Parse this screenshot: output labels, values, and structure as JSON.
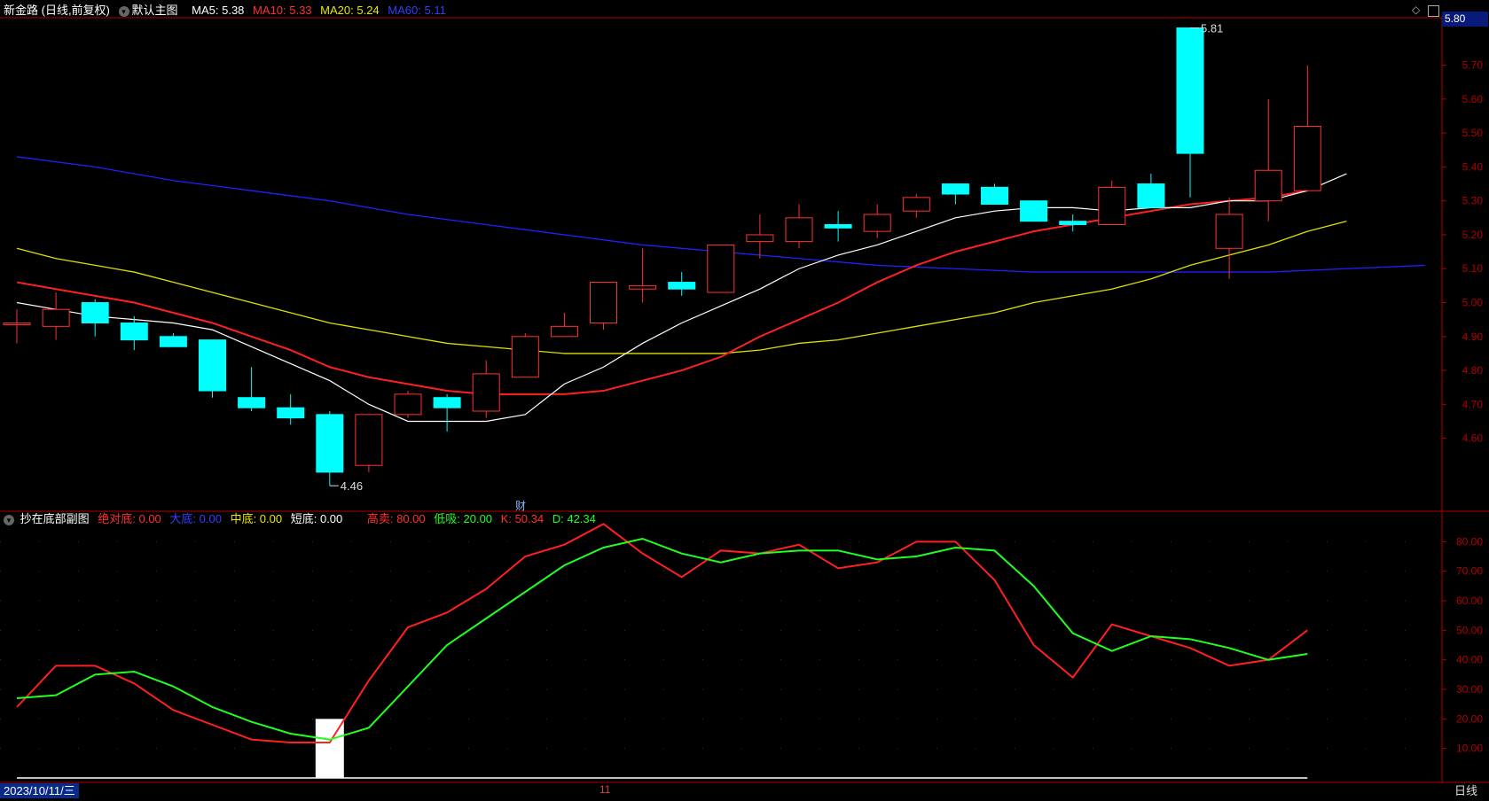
{
  "header": {
    "stock_name": "新金路 (日线,前复权)",
    "chart_mode": "默认主图",
    "ma5_label": "MA5: 5.38",
    "ma10_label": "MA10: 5.33",
    "ma20_label": "MA20: 5.24",
    "ma60_label": "MA60: 5.11"
  },
  "sub_header": {
    "indicator_name": "抄在底部副图",
    "abs_bottom": "绝对底: 0.00",
    "big_bottom": "大底: 0.00",
    "mid_bottom": "中底: 0.00",
    "short_bottom": "短底: 0.00",
    "high_sell": "高卖: 80.00",
    "low_buy": "低吸: 20.00",
    "k_value": "K: 50.34",
    "d_value": "D: 42.34"
  },
  "colors": {
    "up": "#ff3232",
    "down": "#00ffff",
    "ma5": "#ffffff",
    "ma10": "#ff2020",
    "ma20": "#e0e000",
    "ma60": "#2020ff",
    "k": "#ff2020",
    "d": "#20ff20",
    "axis": "#b00000"
  },
  "footer": {
    "date": "2023/10/11/三",
    "period": "日线",
    "month_mark": "11",
    "fin_mark": "财"
  },
  "price_badge": "5.80",
  "max_label": "5.81",
  "min_label": "4.46",
  "chart_data": [
    {
      "type": "candlestick",
      "yaxis_ticks": [
        "5.70",
        "5.60",
        "5.50",
        "5.40",
        "5.30",
        "5.20",
        "5.10",
        "5.00",
        "4.90",
        "4.80",
        "4.70",
        "4.60"
      ],
      "ylim": [
        4.39,
        5.84
      ],
      "candles": [
        {
          "o": 4.94,
          "h": 4.98,
          "l": 4.88,
          "c": 4.94
        },
        {
          "o": 4.93,
          "h": 5.03,
          "l": 4.89,
          "c": 4.98
        },
        {
          "o": 5.0,
          "h": 5.01,
          "l": 4.9,
          "c": 4.94
        },
        {
          "o": 4.94,
          "h": 4.96,
          "l": 4.86,
          "c": 4.89
        },
        {
          "o": 4.9,
          "h": 4.91,
          "l": 4.87,
          "c": 4.87
        },
        {
          "o": 4.89,
          "h": 4.89,
          "l": 4.72,
          "c": 4.74
        },
        {
          "o": 4.72,
          "h": 4.81,
          "l": 4.68,
          "c": 4.69
        },
        {
          "o": 4.69,
          "h": 4.73,
          "l": 4.64,
          "c": 4.66
        },
        {
          "o": 4.67,
          "h": 4.68,
          "l": 4.46,
          "c": 4.5
        },
        {
          "o": 4.52,
          "h": 4.67,
          "l": 4.5,
          "c": 4.67
        },
        {
          "o": 4.67,
          "h": 4.74,
          "l": 4.66,
          "c": 4.73
        },
        {
          "o": 4.72,
          "h": 4.73,
          "l": 4.62,
          "c": 4.69
        },
        {
          "o": 4.68,
          "h": 4.83,
          "l": 4.66,
          "c": 4.79
        },
        {
          "o": 4.78,
          "h": 4.91,
          "l": 4.78,
          "c": 4.9
        },
        {
          "o": 4.9,
          "h": 4.97,
          "l": 4.9,
          "c": 4.93
        },
        {
          "o": 4.94,
          "h": 5.06,
          "l": 4.92,
          "c": 5.06
        },
        {
          "o": 5.04,
          "h": 5.16,
          "l": 5.0,
          "c": 5.05
        },
        {
          "o": 5.06,
          "h": 5.09,
          "l": 5.02,
          "c": 5.04
        },
        {
          "o": 5.03,
          "h": 5.17,
          "l": 5.03,
          "c": 5.17
        },
        {
          "o": 5.18,
          "h": 5.26,
          "l": 5.13,
          "c": 5.2
        },
        {
          "o": 5.18,
          "h": 5.29,
          "l": 5.16,
          "c": 5.25
        },
        {
          "o": 5.23,
          "h": 5.27,
          "l": 5.18,
          "c": 5.22
        },
        {
          "o": 5.21,
          "h": 5.29,
          "l": 5.19,
          "c": 5.26
        },
        {
          "o": 5.27,
          "h": 5.32,
          "l": 5.25,
          "c": 5.31
        },
        {
          "o": 5.35,
          "h": 5.35,
          "l": 5.29,
          "c": 5.32
        },
        {
          "o": 5.34,
          "h": 5.35,
          "l": 5.29,
          "c": 5.29
        },
        {
          "o": 5.3,
          "h": 5.3,
          "l": 5.24,
          "c": 5.24
        },
        {
          "o": 5.24,
          "h": 5.26,
          "l": 5.21,
          "c": 5.23
        },
        {
          "o": 5.23,
          "h": 5.36,
          "l": 5.23,
          "c": 5.34
        },
        {
          "o": 5.35,
          "h": 5.38,
          "l": 5.28,
          "c": 5.28
        },
        {
          "o": 5.81,
          "h": 5.81,
          "l": 5.31,
          "c": 5.44
        },
        {
          "o": 5.16,
          "h": 5.31,
          "l": 5.07,
          "c": 5.26
        },
        {
          "o": 5.3,
          "h": 5.6,
          "l": 5.24,
          "c": 5.39
        },
        {
          "o": 5.33,
          "h": 5.7,
          "l": 5.33,
          "c": 5.52
        }
      ],
      "ma5": [
        5.0,
        4.98,
        4.96,
        4.95,
        4.94,
        4.92,
        4.87,
        4.82,
        4.77,
        4.7,
        4.65,
        4.65,
        4.65,
        4.67,
        4.76,
        4.81,
        4.88,
        4.94,
        4.99,
        5.04,
        5.1,
        5.14,
        5.17,
        5.21,
        5.25,
        5.27,
        5.28,
        5.28,
        5.27,
        5.28,
        5.28,
        5.3,
        5.3,
        5.33,
        5.38
      ],
      "ma10": [
        5.06,
        5.04,
        5.02,
        5.0,
        4.97,
        4.94,
        4.9,
        4.86,
        4.81,
        4.78,
        4.76,
        4.74,
        4.73,
        4.73,
        4.73,
        4.74,
        4.77,
        4.8,
        4.84,
        4.9,
        4.95,
        5.0,
        5.06,
        5.11,
        5.15,
        5.18,
        5.21,
        5.23,
        5.25,
        5.27,
        5.29,
        5.3,
        5.31,
        5.33
      ],
      "ma20": [
        5.16,
        5.13,
        5.11,
        5.09,
        5.06,
        5.03,
        5.0,
        4.97,
        4.94,
        4.92,
        4.9,
        4.88,
        4.87,
        4.86,
        4.85,
        4.85,
        4.85,
        4.85,
        4.85,
        4.86,
        4.88,
        4.89,
        4.91,
        4.93,
        4.95,
        4.97,
        5.0,
        5.02,
        5.04,
        5.07,
        5.11,
        5.14,
        5.17,
        5.21,
        5.24
      ],
      "ma60": [
        5.43,
        5.4,
        5.36,
        5.33,
        5.3,
        5.26,
        5.23,
        5.2,
        5.17,
        5.15,
        5.13,
        5.11,
        5.1,
        5.09,
        5.09,
        5.09,
        5.09,
        5.1,
        5.11
      ],
      "ma60_x_step": 2
    },
    {
      "type": "line",
      "title": "抄在底部副图",
      "yaxis_ticks": [
        "80.00",
        "70.00",
        "60.00",
        "50.00",
        "40.00",
        "30.00",
        "20.00",
        "10.00"
      ],
      "ylim": [
        0,
        90
      ],
      "series": [
        {
          "name": "K",
          "values": [
            24,
            38,
            38,
            32,
            23,
            18,
            13,
            12,
            12,
            33,
            51,
            56,
            64,
            75,
            79,
            86,
            76,
            68,
            77,
            76,
            79,
            71,
            73,
            80,
            80,
            67,
            45,
            34,
            52,
            48,
            44,
            38,
            40,
            50
          ]
        },
        {
          "name": "D",
          "values": [
            27,
            28,
            35,
            36,
            31,
            24,
            19,
            15,
            13,
            17,
            31,
            45,
            54,
            63,
            72,
            78,
            81,
            76,
            73,
            76,
            77,
            77,
            74,
            75,
            78,
            77,
            65,
            49,
            43,
            48,
            47,
            44,
            40,
            42
          ]
        }
      ],
      "signal_bar": {
        "index": 8,
        "value": 20
      },
      "reference_lines": [
        80,
        20
      ]
    }
  ]
}
